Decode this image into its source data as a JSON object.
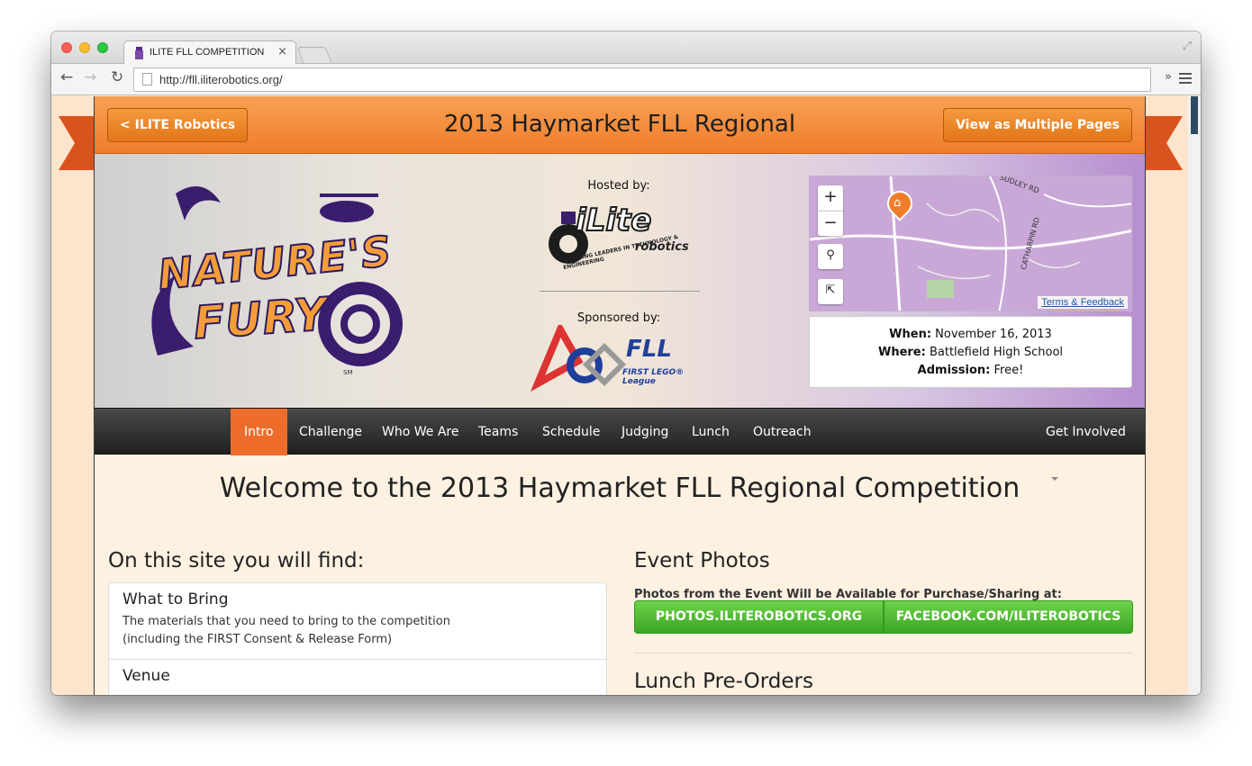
{
  "browser": {
    "tab_title": "ILITE FLL COMPETITION",
    "tab_close": "×",
    "url": "http://fll.iliterobotics.org/",
    "back": "←",
    "forward": "→",
    "reload": "↻",
    "overflow": "»"
  },
  "header": {
    "ilite_button": "< ILITE Robotics",
    "title": "2013 Haymarket FLL Regional",
    "multi_button": "View as Multiple Pages"
  },
  "hero": {
    "logo_line1": "NATURE'S",
    "logo_line2": "FURY",
    "logo_sm": "SM",
    "hosted_label": "Hosted by:",
    "ilite_logo_word": "iLite",
    "ilite_tagline": "INSPIRING LEADERS IN TECHNOLOGY & ENGINEERING",
    "ilite_robotics": "robotics",
    "sponsored_label": "Sponsored by:",
    "fll_word": "FLL",
    "fll_sub": "FIRST LEGO® League"
  },
  "map": {
    "zoom_in": "+",
    "zoom_out": "−",
    "terms_link": "Terms & Feedback",
    "road1": "SUDLEY RD",
    "road2": "CATHARPIN RD"
  },
  "event": {
    "when_label": "When:",
    "when_value": "November 16, 2013",
    "where_label": "Where:",
    "where_value": "Battlefield High School",
    "admission_label": "Admission:",
    "admission_value": "Free!"
  },
  "nav": {
    "items": [
      "Intro",
      "Challenge",
      "Who We Are",
      "Teams",
      "Schedule",
      "Judging",
      "Lunch",
      "Outreach"
    ],
    "get_involved": "Get Involved"
  },
  "main": {
    "welcome": "Welcome to the 2013 Haymarket FLL Regional Competition",
    "find_title": "On this site you will find:",
    "find_items": [
      {
        "heading": "What to Bring",
        "line1": "The materials that you need to bring to the competition",
        "line2": "(including the FIRST Consent & Release Form)"
      },
      {
        "heading": "Venue"
      }
    ],
    "photos_title": "Event Photos",
    "photos_subtitle": "Photos from the Event Will be Available for Purchase/Sharing at:",
    "photos_button1": "PHOTOS.ILITEROBOTICS.ORG",
    "photos_button2": "FACEBOOK.COM/ILITEROBOTICS",
    "lunch_title": "Lunch Pre-Orders"
  },
  "colors": {
    "brand_orange": "#ef7d2a",
    "nav_active": "#ef6d2b",
    "green_button": "#3aa524",
    "ribbon": "#d9531e"
  }
}
